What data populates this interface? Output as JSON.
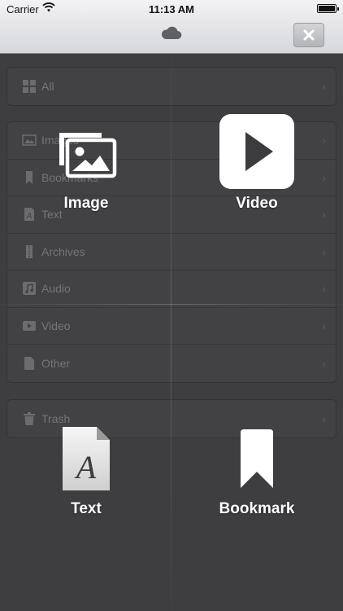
{
  "status_bar": {
    "carrier": "Carrier",
    "time": "11:13 AM"
  },
  "nav": {
    "icon": "cloud-icon",
    "close_icon": "close-icon"
  },
  "list": {
    "group_all": [
      {
        "label": "All",
        "icon": "grid-icon"
      }
    ],
    "group_types": [
      {
        "label": "Images",
        "icon": "image-icon"
      },
      {
        "label": "Bookmarks",
        "icon": "bookmark-icon"
      },
      {
        "label": "Text",
        "icon": "text-icon"
      },
      {
        "label": "Archives",
        "icon": "archive-icon"
      },
      {
        "label": "Audio",
        "icon": "audio-icon"
      },
      {
        "label": "Video",
        "icon": "video-icon"
      },
      {
        "label": "Other",
        "icon": "file-icon"
      }
    ],
    "group_trash": [
      {
        "label": "Trash",
        "icon": "trash-icon"
      }
    ]
  },
  "actions": {
    "image": {
      "label": "Image",
      "icon": "image-icon"
    },
    "video": {
      "label": "Video",
      "icon": "play-icon"
    },
    "text": {
      "label": "Text",
      "icon": "text-file-icon"
    },
    "bookmark": {
      "label": "Bookmark",
      "icon": "bookmark-icon"
    }
  }
}
